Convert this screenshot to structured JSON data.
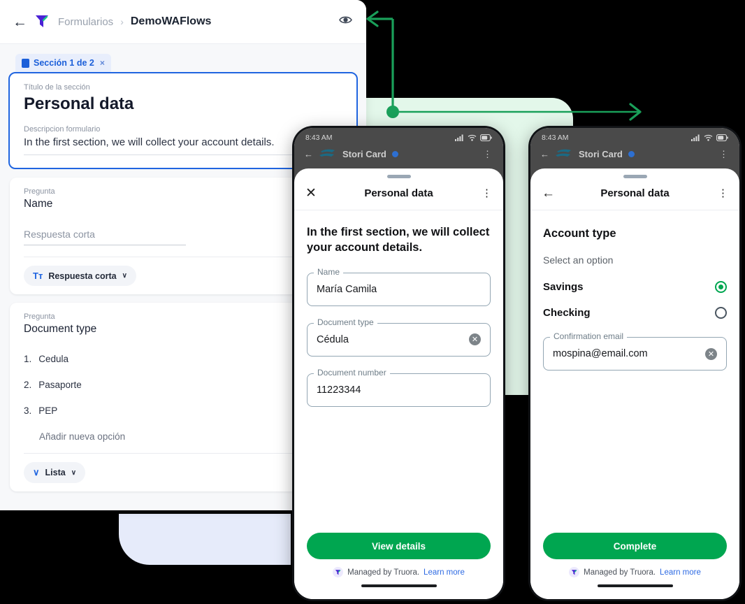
{
  "builder": {
    "topbar": {
      "back_icon": "arrow-left-icon",
      "logo_icon": "truora-logo-icon",
      "breadcrumb_parent": "Formularios",
      "breadcrumb_separator": "›",
      "breadcrumb_current": "DemoWAFlows",
      "preview_icon": "eye-icon"
    },
    "section_tab": {
      "icon": "document-icon",
      "label": "Sección 1 de 2",
      "close": "×"
    },
    "section_card": {
      "title_label": "Título de la sección",
      "title_value": "Personal data",
      "desc_label": "Descripcion formulario",
      "desc_value": "In the first section, we will collect your account details."
    },
    "questions": [
      {
        "label": "Pregunta",
        "title": "Name",
        "answer_placeholder": "Respuesta corta",
        "type_icon": "Tт",
        "type_label": "Respuesta corta",
        "caret": "∨",
        "toggle_on": true
      },
      {
        "label": "Pregunta",
        "title": "Document type",
        "options": [
          {
            "num": "1.",
            "text": "Cedula"
          },
          {
            "num": "2.",
            "text": "Pasaporte"
          },
          {
            "num": "3.",
            "text": "PEP"
          }
        ],
        "add_option": "Añadir nueva opción",
        "type_icon": "∨",
        "type_label": "Lista",
        "caret": "∨",
        "toggle_on": true
      }
    ]
  },
  "phone_a": {
    "status": {
      "time": "8:43 AM",
      "signal_icon": "signal-icon",
      "wifi_icon": "wifi-icon",
      "battery_icon": "battery-icon"
    },
    "whatsapp": {
      "back_icon": "arrow-left-icon",
      "avatar_icon": "stori-logo-icon",
      "contact": "Stori Card",
      "verified_icon": "verified-badge-icon",
      "kebab_icon": "kebab-menu-icon"
    },
    "sheet": {
      "nav_icon": "close-icon",
      "nav_glyph": "✕",
      "title": "Personal data",
      "kebab_glyph": "⋮",
      "lead": "In the first section, we will collect your account details.",
      "fields": [
        {
          "legend": "Name",
          "value": "María Camila",
          "clear": false
        },
        {
          "legend": "Document type",
          "value": "Cédula",
          "clear": true
        },
        {
          "legend": "Document number",
          "value": "11223344",
          "clear": false
        }
      ],
      "cta": "View details",
      "managed_prefix": "Managed by Truora.",
      "managed_link": "Learn more"
    }
  },
  "phone_b": {
    "status": {
      "time": "8:43 AM",
      "signal_icon": "signal-icon",
      "wifi_icon": "wifi-icon",
      "battery_icon": "battery-icon"
    },
    "whatsapp": {
      "back_icon": "arrow-left-icon",
      "avatar_icon": "stori-logo-icon",
      "contact": "Stori Card",
      "verified_icon": "verified-badge-icon",
      "kebab_icon": "kebab-menu-icon"
    },
    "sheet": {
      "nav_icon": "back-icon",
      "nav_glyph": "←",
      "title": "Personal data",
      "kebab_glyph": "⋮",
      "heading": "Account type",
      "subtitle": "Select an option",
      "options": [
        {
          "label": "Savings",
          "selected": true
        },
        {
          "label": "Checking",
          "selected": false
        }
      ],
      "fields": [
        {
          "legend": "Confirmation email",
          "value": "mospina@email.com",
          "clear": true
        }
      ],
      "cta": "Complete",
      "managed_prefix": "Managed by Truora.",
      "managed_link": "Learn more"
    }
  },
  "colors": {
    "accent_blue": "#2065e0",
    "accent_green": "#00a650",
    "mint_bg": "#e3f7ea",
    "lavender_bg": "#e6ebfa",
    "brand_purple": "#4b22d5"
  }
}
